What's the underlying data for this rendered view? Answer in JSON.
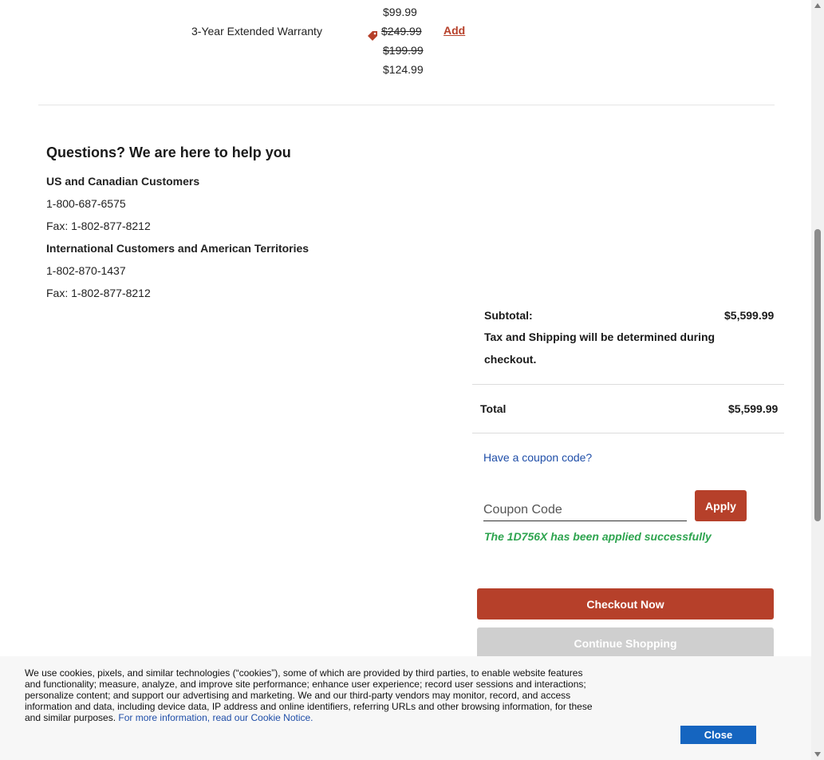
{
  "warranty": {
    "label": "3-Year Extended Warranty",
    "prices": [
      "$99.99",
      "$249.99",
      "$199.99",
      "$124.99"
    ],
    "add_label": "Add"
  },
  "help": {
    "title": "Questions? We are here to help you",
    "us_heading": "US and Canadian Customers",
    "us_phone": "1-800-687-6575",
    "us_fax": "Fax: 1-802-877-8212",
    "intl_heading": "International Customers and American Territories",
    "intl_phone": "1-802-870-1437",
    "intl_fax": "Fax: 1-802-877-8212"
  },
  "summary": {
    "subtotal_label": "Subtotal:",
    "subtotal_value": "$5,599.99",
    "tax_note": "Tax and Shipping will be determined during checkout.",
    "total_label": "Total",
    "total_value": "$5,599.99"
  },
  "coupon": {
    "link_label": "Have a coupon code?",
    "placeholder": "Coupon Code",
    "apply_label": "Apply",
    "success_message": "The 1D756X has been applied successfully"
  },
  "actions": {
    "checkout_label": "Checkout Now",
    "continue_label": "Continue Shopping"
  },
  "cookie_banner": {
    "text": "We use cookies, pixels, and similar technologies (“cookies”), some of which are provided by third parties, to enable website features and functionality; measure, analyze, and improve site performance; enhance user experience; record user sessions and interactions; personalize content; and support our advertising and marketing. We and our third-party vendors may monitor, record, and access information and data, including device data, IP address and online identifiers, referring URLs and other browsing information, for these and similar purposes.",
    "link_label": "For more information, read our Cookie Notice.",
    "close_label": "Close"
  },
  "colors": {
    "brand_red": "#b6402a",
    "link_blue": "#1f4ea8",
    "success_green": "#2ea44f",
    "close_blue": "#1565c0"
  }
}
